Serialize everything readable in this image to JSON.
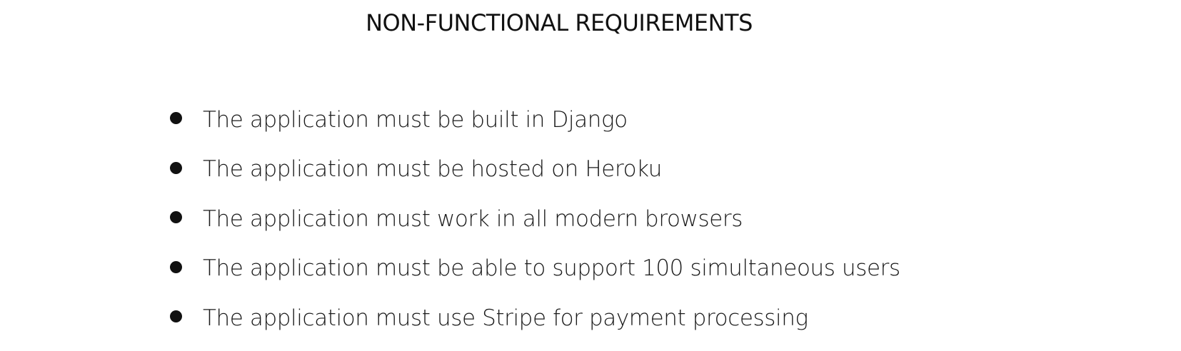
{
  "document": {
    "title": "NON-FUNCTIONAL REQUIREMENTS",
    "requirements": [
      "The application must be built in Django",
      "The application must be hosted on Heroku",
      "The application must work in all modern browsers",
      "The application must be able to support 100 simultaneous users",
      "The application must use Stripe for payment processing"
    ]
  }
}
